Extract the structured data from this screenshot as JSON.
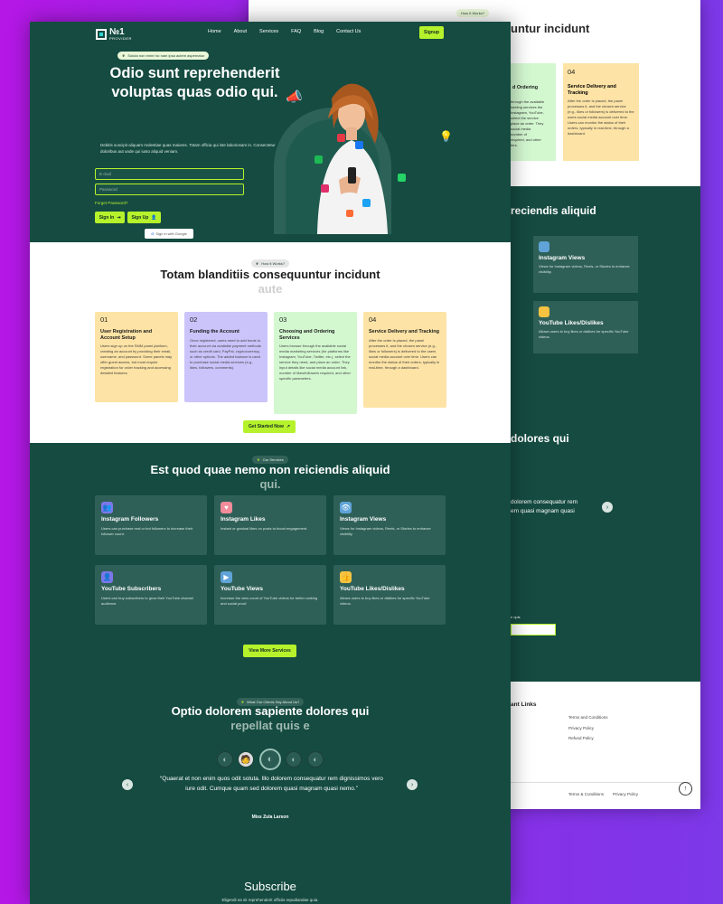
{
  "back_page": {
    "pill": "How It Works?",
    "title_fragment": "untur incidunt",
    "card_partial_title": "d Ordering",
    "card_partial_desc": "through the available\nkeeting services the\nInstagram, YouTube,\nselect the service\nplace an order. They\nsocial media\nnumber of\nrequired, and other\nters.",
    "card4_num": "04",
    "card4_title": "Service Delivery and Tracking",
    "card4_desc": "After the order is placed, the panel processes it, and the chosen service (e.g., likes or followers) is delivered to the users social media account over time. Users can monitor the status of their orders, typically in real-time, through a dashboard.",
    "dark_title": "reciendis aliquid",
    "svc_a_title": "Instagram Views",
    "svc_a_desc": "Views for Instagram videos, Reels, or Stories to enhance visibility.",
    "svc_b_title": "YouTube Likes/Dislikes",
    "svc_b_desc": "Allows users to buy likes or dislikes for specific YouTube videos.",
    "testimonial_title": "dolores qui",
    "testimonial_text": "dolorem consequatur rem\nem quasi magnam quasi",
    "subscribe_hint": "e quis",
    "footer_heading": "ant Links",
    "footer_links": [
      "Terms and Conditions",
      "Privacy Policy",
      "Refund Policy"
    ],
    "bottom_links": [
      "Terms & Conditions",
      "Privacy Policy"
    ]
  },
  "nav": {
    "logo": "№1",
    "logo_sub": "PROVIDER",
    "items": [
      "Home",
      "About",
      "Services",
      "FAQ",
      "Blog",
      "Contact Us"
    ],
    "signup": "Signup"
  },
  "hero": {
    "pill": "Soluta non enim hic nam ipsa autem aspernatur",
    "title": "Odio sunt reprehenderit voluptas quas odio qui.",
    "subtitle": "Debitis suscipit aliquam molestiae quas maiores. Totam officia qui iste laboriosam in. Consectetur doloribus aut unde qui iusto aliquid veniam.",
    "email_placeholder": "E-mail",
    "password_placeholder": "Password",
    "forgot": "Forget Password?",
    "signin": "Sign In",
    "signupbtn": "Sign Up",
    "google": "Sign in with Google"
  },
  "how": {
    "pill": "How It Works?",
    "title": "Totam blanditiis consequuntur incidunt",
    "title_fade": "aute",
    "cards": [
      {
        "num": "01",
        "title": "User Registration and Account Setup",
        "desc": "Users sign up on the SMM panel platform, creating an account by providing their email, username, and password. Some panels may offer guest access, but most require registration for order tracking and accessing detailed features.",
        "color": "#fde3a5"
      },
      {
        "num": "02",
        "title": "Funding the Account",
        "desc": "Once registered, users need to add funds to their account via available payment methods such as credit card, PayPal, cryptocurrency, or other options. The added balance is used to purchase social media services (e.g., likes, followers, comments).",
        "color": "#cbc4fb"
      },
      {
        "num": "03",
        "title": "Choosing and Ordering Services",
        "desc": "Users browse through the available social media marketing services (for platforms like Instagram, YouTube, Twitter, etc.), select the service they need, and place an order. They input details like social media account link, number of likes/followers required, and other specific parameters.",
        "color": "#d3f8d0"
      },
      {
        "num": "04",
        "title": "Service Delivery and Tracking",
        "desc": "After the order is placed, the panel processes it, and the chosen service (e.g., likes or followers) is delivered to the users social media account over time. Users can monitor the status of their orders, typically in real-time, through a dashboard.",
        "color": "#fde3a5"
      }
    ],
    "cta": "Get Started Now"
  },
  "services": {
    "pill": "Our Services",
    "title": "Est quod quae nemo non reiciendis aliquid",
    "title_fade": "qui.",
    "items": [
      {
        "title": "Instagram Followers",
        "desc": "Users can purchase real or bot followers to increase their follower count.",
        "icon": "followers-icon"
      },
      {
        "title": "Instagram Likes",
        "desc": "Instant or gradual likes on posts to boost engagement.",
        "icon": "likes-icon"
      },
      {
        "title": "Instagram Views",
        "desc": "Views for Instagram videos, Reels, or Stories to enhance visibility.",
        "icon": "views-icon"
      },
      {
        "title": "YouTube Subscribers",
        "desc": "Users can buy subscribers to grow their YouTube channel audience.",
        "icon": "subscribers-icon"
      },
      {
        "title": "YouTube Views",
        "desc": "Increase the view count of YouTube videos for better ranking and social proof.",
        "icon": "youtube-views-icon"
      },
      {
        "title": "YouTube Likes/Dislikes",
        "desc": "Allows users to buy likes or dislikes for specific YouTube videos.",
        "icon": "thumbs-icon"
      }
    ],
    "cta": "View More Services"
  },
  "testimonials": {
    "pill": "What Our Clients Say About Us?",
    "title": "Optio dolorem sapiente dolores qui",
    "title_fade": "repellat quis e",
    "quote": "“Quaerat et non enim quos odit soluta. Illo dolorem consequatur rem dignissimos vero iure odit. Cumque quam sed dolorem quasi magnam quasi nemo.”",
    "author": "Miss Zula Larson"
  },
  "subscribe": {
    "title": "Subscribe",
    "text": "Eligendi ea sit reprehenderit officiis repudiandae quia."
  },
  "colors": {
    "brand_dark": "#154b41",
    "accent": "#b6f22c",
    "background": "#9a2be8"
  }
}
